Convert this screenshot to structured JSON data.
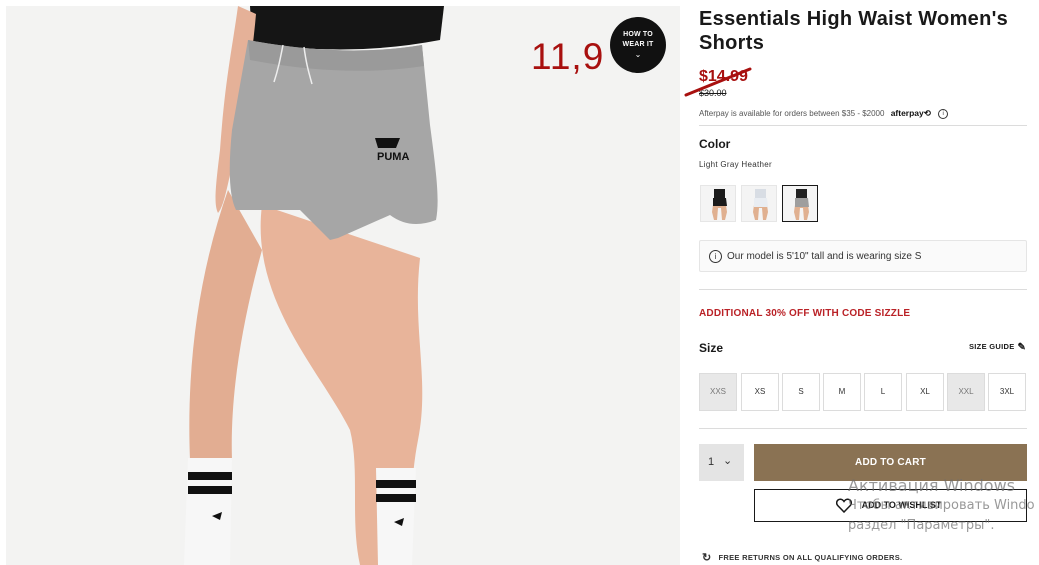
{
  "image_overlay": {
    "price_annotation": "11,9",
    "how_to_wear": {
      "line1": "HOW TO",
      "line2": "WEAR IT",
      "chevron": "⌄"
    }
  },
  "product": {
    "title": "Essentials High Waist Women's Shorts",
    "sale_price": "$14.99",
    "original_price": "$30.00",
    "afterpay": {
      "text": "Afterpay is available for orders between $35 - $2000",
      "logo": "afterpay⟲",
      "info_icon": "i"
    }
  },
  "color": {
    "label": "Color",
    "value": "Light Gray Heather",
    "swatches": [
      {
        "name": "black",
        "shorts_color": "#1b1b1b"
      },
      {
        "name": "white",
        "shorts_color": "#e9edf2"
      },
      {
        "name": "light-gray-heather",
        "shorts_color": "#9e9e9e",
        "selected": true
      }
    ]
  },
  "model_note": {
    "icon": "i",
    "text": "Our model is 5'10\" tall and is wearing size S"
  },
  "promo": "ADDITIONAL 30% OFF WITH CODE SIZZLE",
  "size": {
    "label": "Size",
    "guide_label": "SIZE GUIDE",
    "options": [
      {
        "label": "XXS",
        "available": false
      },
      {
        "label": "XS",
        "available": true
      },
      {
        "label": "S",
        "available": true
      },
      {
        "label": "M",
        "available": true
      },
      {
        "label": "L",
        "available": true
      },
      {
        "label": "XL",
        "available": true
      },
      {
        "label": "XXL",
        "available": false
      },
      {
        "label": "3XL",
        "available": true
      }
    ]
  },
  "purchase": {
    "quantity": "1",
    "quantity_chevron": "⌄",
    "add_to_cart": "ADD TO CART",
    "add_to_wishlist": "ADD TO WISHLIST"
  },
  "returns": {
    "icon": "↻",
    "text": "FREE RETURNS ON ALL QUALIFYING ORDERS."
  },
  "watermark": {
    "line1": "Активация Windows",
    "line2": "Чтобы активировать Windo",
    "line3": "раздел \"Параметры\"."
  },
  "colors": {
    "sale_red": "#a8100f",
    "promo_red": "#ba2227",
    "cart_brown": "#8a7253"
  }
}
